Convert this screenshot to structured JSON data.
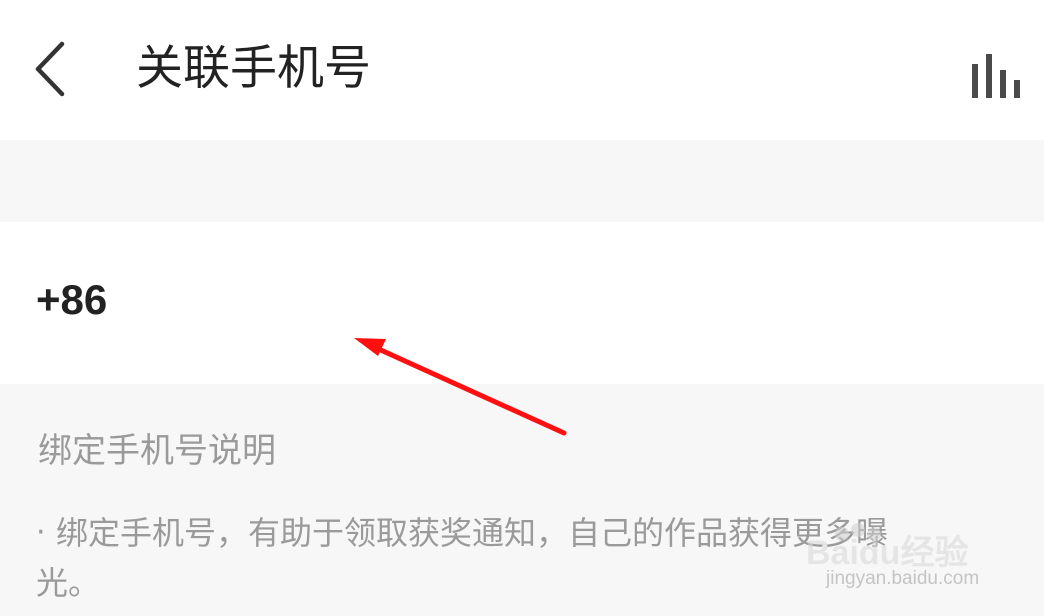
{
  "header": {
    "back_icon": "chevron-left-icon",
    "title": "关联手机号",
    "stats_icon": "bar-chart-icon"
  },
  "phone": {
    "country_code": "+86",
    "number_value": "",
    "number_placeholder": ""
  },
  "annotation": {
    "color": "#ff0000"
  },
  "description": {
    "title": "绑定手机号说明",
    "bullet": "·",
    "body_line1": "绑定手机号，有助于领取获奖通知，自己的作品获得更多曝",
    "body_line2": "光。"
  },
  "watermark": {
    "logo_text": "Baidu经验",
    "url": "jingyan.baidu.com"
  },
  "colors": {
    "background": "#f7f7f7",
    "surface": "#ffffff",
    "text_primary": "#222222",
    "text_secondary": "#9a9a9a"
  }
}
